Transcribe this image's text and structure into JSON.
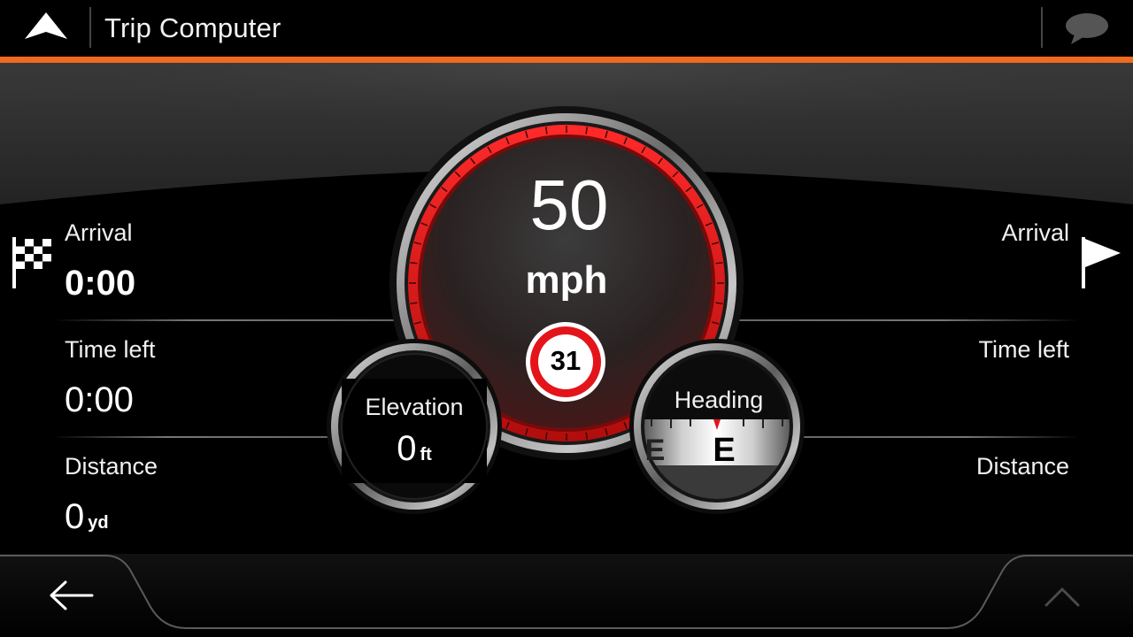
{
  "header": {
    "title": "Trip Computer",
    "logo_icon": "navigation-arrow-icon",
    "menu_icon": "speech-bubble-icon",
    "accent_color": "#ef6a1e"
  },
  "left_panel": {
    "arrival_label": "Arrival",
    "arrival_value": "0:00",
    "time_left_label": "Time left",
    "time_left_value": "0:00",
    "distance_label": "Distance",
    "distance_value": "0",
    "distance_unit": "yd",
    "flag_icon": "checkered-flag-icon"
  },
  "right_panel": {
    "arrival_label": "Arrival",
    "time_left_label": "Time left",
    "distance_label": "Distance",
    "flag_icon": "waypoint-flag-icon"
  },
  "speedometer": {
    "speed": "50",
    "unit": "mph",
    "speed_limit": "31",
    "ring_color": "#e3151a"
  },
  "elevation": {
    "label": "Elevation",
    "value": "0",
    "unit": "ft"
  },
  "heading": {
    "label": "Heading",
    "direction": "E",
    "side_letter": "E"
  },
  "footer": {
    "back_icon": "back-arrow-icon",
    "expand_icon": "chevron-up-icon"
  }
}
